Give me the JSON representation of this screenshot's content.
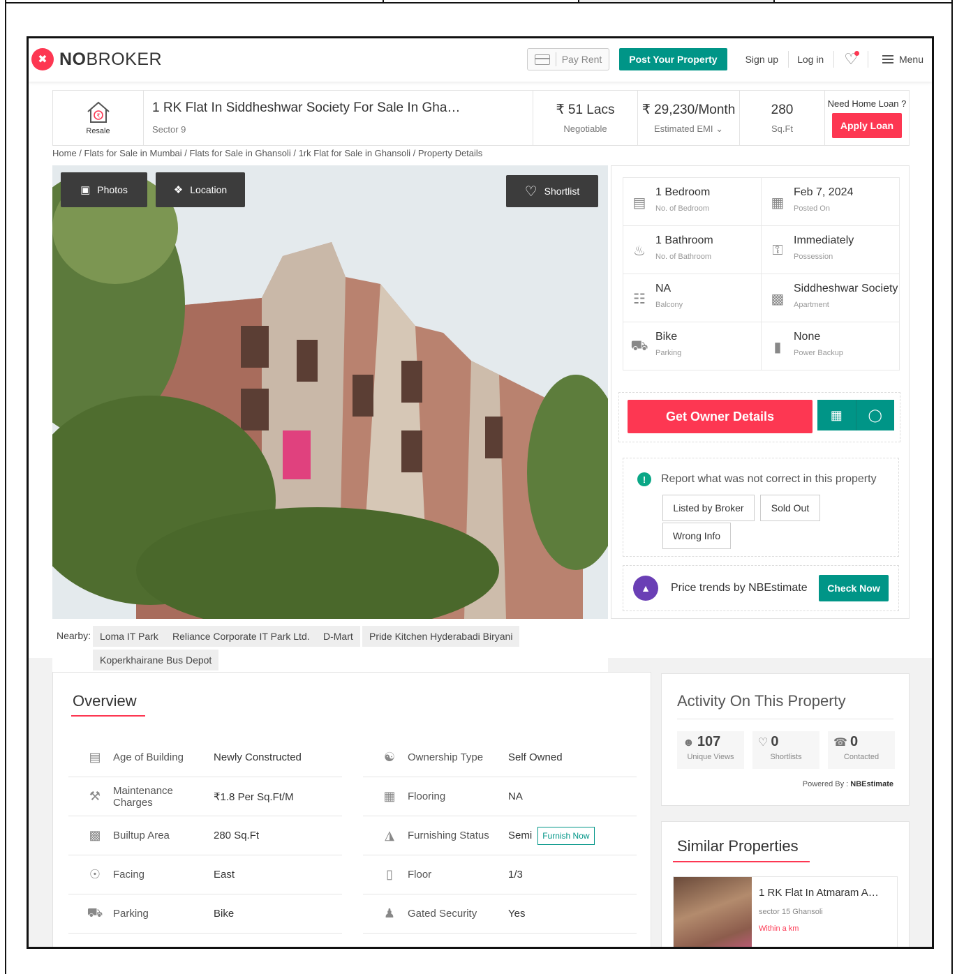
{
  "brand": {
    "name_bold": "NO",
    "name_rest": "BROKER",
    "accent": "#fd3752",
    "green": "#009587"
  },
  "nav": {
    "pay_rent": "Pay Rent",
    "post": "Post Your Property",
    "signup": "Sign up",
    "login": "Log in",
    "menu": "Menu"
  },
  "listing": {
    "badge": "Resale",
    "title": "1 RK Flat In Siddheshwar Society For Sale In Gha…",
    "location": "Sector 9",
    "price": "₹ 51 Lacs",
    "price_note": "Negotiable",
    "emi": "₹ 29,230/Month",
    "emi_note": "Estimated EMI",
    "area": "280",
    "area_unit": "Sq.Ft",
    "loan_q": "Need Home Loan ?",
    "loan_btn": "Apply Loan"
  },
  "breadcrumb": "Home / Flats for Sale in Mumbai / Flats for Sale in Ghansoli / 1rk Flat for Sale in Ghansoli / Property Details",
  "photo_buttons": {
    "photos": "Photos",
    "location": "Location",
    "shortlist": "Shortlist"
  },
  "specs": [
    {
      "value": "1 Bedroom",
      "label": "No. of Bedroom",
      "icon": "bed-icon"
    },
    {
      "value": "Feb 7, 2024",
      "label": "Posted On",
      "icon": "calendar-icon"
    },
    {
      "value": "1 Bathroom",
      "label": "No. of Bathroom",
      "icon": "bath-icon"
    },
    {
      "value": "Immediately",
      "label": "Possession",
      "icon": "key-icon"
    },
    {
      "value": "NA",
      "label": "Balcony",
      "icon": "balcony-icon"
    },
    {
      "value": "Siddheshwar Society",
      "label": "Apartment",
      "icon": "building-icon"
    },
    {
      "value": "Bike",
      "label": "Parking",
      "icon": "car-icon"
    },
    {
      "value": "None",
      "label": "Power Backup",
      "icon": "battery-icon"
    }
  ],
  "owner_btn": "Get Owner Details",
  "report": {
    "heading": "Report what was not correct in this property",
    "chips": [
      "Listed by Broker",
      "Sold Out",
      "Wrong Info"
    ]
  },
  "trend": {
    "text": "Price trends by NBEstimate",
    "btn": "Check Now"
  },
  "nearby": {
    "label": "Nearby:",
    "items": [
      "Loma IT Park",
      "Reliance Corporate IT Park Ltd.",
      "D-Mart",
      "Pride Kitchen Hyderabadi Biryani",
      "Koperkhairane Bus Depot"
    ]
  },
  "overview": {
    "title": "Overview",
    "rows": [
      {
        "label": "Age of Building",
        "value": "Newly Constructed",
        "icon": "cake-icon"
      },
      {
        "label": "Ownership Type",
        "value": "Self Owned",
        "icon": "ownership-icon"
      },
      {
        "label": "Maintenance Charges",
        "value": "₹1.8 Per Sq.Ft/M",
        "icon": "tools-icon"
      },
      {
        "label": "Flooring",
        "value": "NA",
        "icon": "grid-icon"
      },
      {
        "label": "Builtup Area",
        "value": "280 Sq.Ft",
        "icon": "area-icon"
      },
      {
        "label": "Furnishing Status",
        "value": "Semi",
        "icon": "sofa-icon"
      },
      {
        "label": "Facing",
        "value": "East",
        "icon": "compass-icon"
      },
      {
        "label": "Floor",
        "value": "1/3",
        "icon": "floor-icon"
      },
      {
        "label": "Parking",
        "value": "Bike",
        "icon": "car-icon"
      },
      {
        "label": "Gated Security",
        "value": "Yes",
        "icon": "guard-icon"
      }
    ],
    "furnish_btn": "Furnish Now"
  },
  "activity": {
    "title": "Activity On This Property",
    "stats": [
      {
        "value": "107",
        "label": "Unique Views",
        "icon": "user-icon"
      },
      {
        "value": "0",
        "label": "Shortlists",
        "icon": "heart-icon"
      },
      {
        "value": "0",
        "label": "Contacted",
        "icon": "phone-icon"
      }
    ],
    "powered_label": "Powered By :",
    "powered_name": "NBEstimate"
  },
  "similar": {
    "title": "Similar Properties",
    "item_title": "1 RK Flat In Atmaram A…",
    "item_loc": "sector 15 Ghansoli",
    "item_dist": "Within a km"
  }
}
